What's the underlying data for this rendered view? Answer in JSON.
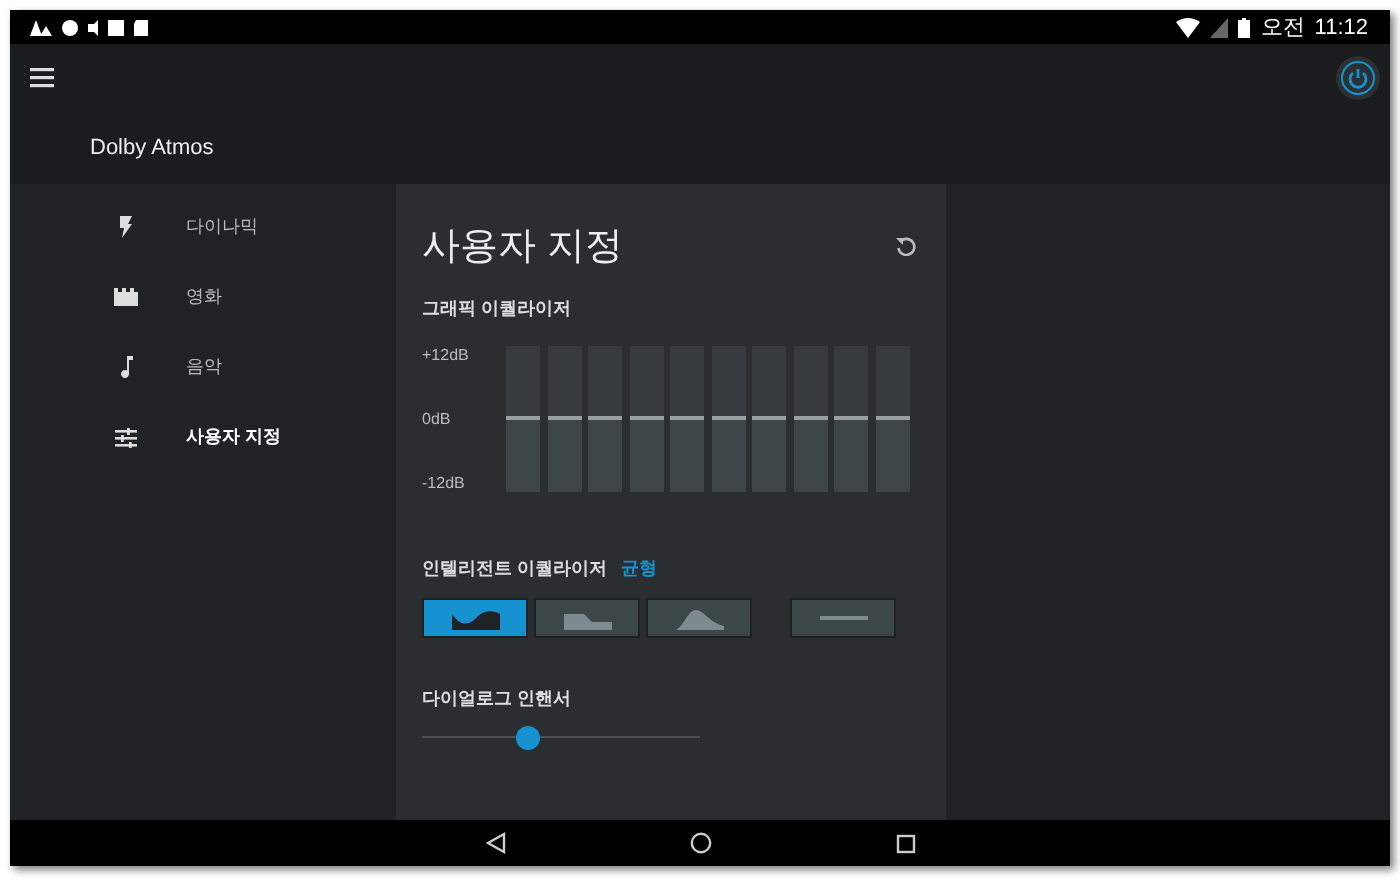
{
  "status_bar": {
    "clock_period": "오전",
    "time": "11:12"
  },
  "app_bar": {
    "title": "Dolby Atmos",
    "power_on": true
  },
  "sidebar": {
    "items": [
      {
        "label": "다이나믹",
        "kind": "bolt",
        "selected": false
      },
      {
        "label": "영화",
        "kind": "film",
        "selected": false
      },
      {
        "label": "음악",
        "kind": "note",
        "selected": false
      },
      {
        "label": "사용자 지정",
        "kind": "sliders",
        "selected": true
      }
    ]
  },
  "panel": {
    "title": "사용자 지정",
    "graphic_eq": {
      "label": "그래픽 이퀄라이저",
      "scale": [
        "+12dB",
        "0dB",
        "-12dB"
      ],
      "bands": [
        {
          "level": 0.5
        },
        {
          "level": 0.5
        },
        {
          "level": 0.5
        },
        {
          "level": 0.5
        },
        {
          "level": 0.5
        },
        {
          "level": 0.5
        },
        {
          "level": 0.5
        },
        {
          "level": 0.5
        },
        {
          "level": 0.5
        },
        {
          "level": 0.5
        }
      ]
    },
    "intelligent_eq": {
      "label": "인텔리전트 이퀄라이저",
      "preset": "균형",
      "options": [
        {
          "kind": "valley",
          "selected": true
        },
        {
          "kind": "step",
          "selected": false
        },
        {
          "kind": "hill",
          "selected": false
        },
        {
          "kind": "flat",
          "selected": false
        }
      ]
    },
    "dialogue_enhancer": {
      "label": "다이얼로그 인핸서",
      "level": 0.38
    }
  }
}
